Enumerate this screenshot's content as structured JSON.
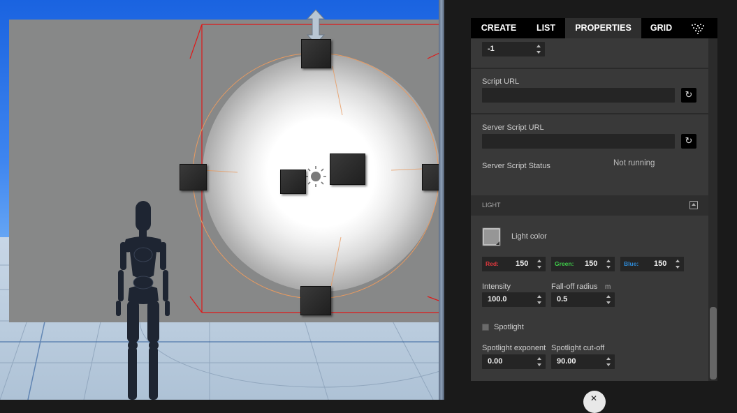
{
  "tabs": [
    {
      "label": "CREATE"
    },
    {
      "label": "LIST"
    },
    {
      "label": "PROPERTIES"
    },
    {
      "label": "GRID"
    }
  ],
  "properties": {
    "top_value": "-1",
    "script_url": {
      "label": "Script URL",
      "value": ""
    },
    "server_script_url": {
      "label": "Server Script URL",
      "value": ""
    },
    "server_script_status": {
      "label": "Server Script Status",
      "value": "Not running"
    },
    "light_section": {
      "title": "LIGHT"
    },
    "light_color": {
      "label": "Light color",
      "swatch_hex": "#969696",
      "red": {
        "label": "Red:",
        "value": "150",
        "color": "#e0383e"
      },
      "green": {
        "label": "Green:",
        "value": "150",
        "color": "#3fce4a"
      },
      "blue": {
        "label": "Blue:",
        "value": "150",
        "color": "#2e8bd8"
      }
    },
    "intensity": {
      "label": "Intensity",
      "value": "100.0"
    },
    "falloff": {
      "label": "Fall-off radius",
      "unit": "m",
      "value": "0.5"
    },
    "spotlight": {
      "label": "Spotlight",
      "checked": false
    },
    "spotlight_exponent": {
      "label": "Spotlight exponent",
      "value": "0.00"
    },
    "spotlight_cutoff": {
      "label": "Spotlight cut-off",
      "value": "90.00"
    }
  }
}
